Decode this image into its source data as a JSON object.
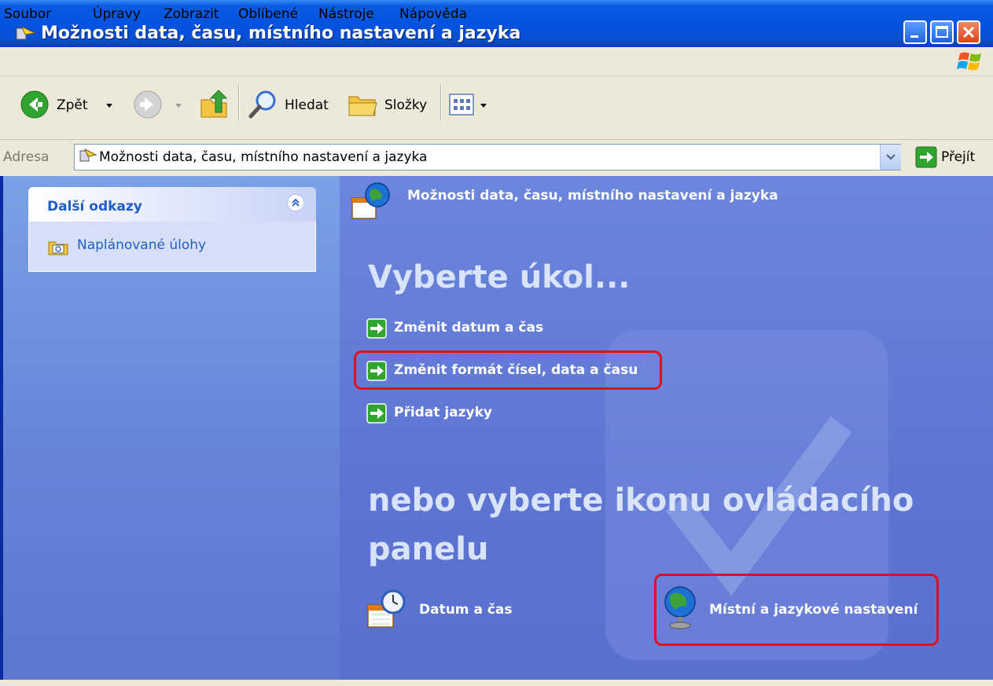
{
  "window": {
    "title": "Možnosti data, času, místního nastavení a jazyka"
  },
  "menu": {
    "items": [
      "Soubor",
      "Úpravy",
      "Zobrazit",
      "Oblíbené",
      "Nástroje",
      "Nápověda"
    ]
  },
  "toolbar": {
    "back_label": "Zpět",
    "search_label": "Hledat",
    "folders_label": "Složky"
  },
  "address": {
    "label": "Adresa",
    "value": "Možnosti data, času, místního nastavení a jazyka",
    "go_label": "Přejít"
  },
  "sidebar": {
    "box_title": "Další odkazy",
    "links": [
      "Naplánované úlohy"
    ]
  },
  "main": {
    "category_title": "Možnosti data, času, místního nastavení a jazyka",
    "pick_task": "Vyberte úkol...",
    "tasks": [
      "Změnit datum a čas",
      "Změnit formát čísel, data a času",
      "Přidat jazyky"
    ],
    "pick_icon": "nebo vyberte ikonu ovládacího panelu",
    "icons": [
      "Datum a čas",
      "Místní a jazykové nastavení"
    ]
  },
  "colors": {
    "highlight": "#e0101e",
    "link": "#215dc6"
  }
}
